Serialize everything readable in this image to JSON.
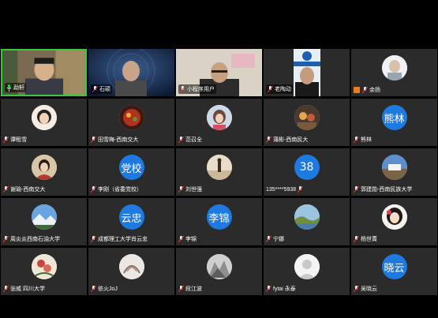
{
  "colors": {
    "background": "#000000",
    "tile": "#2b2b2b",
    "speaking_border": "#37c93d",
    "initials_bubble": "#1f7ae0",
    "mic_muted": "#e53935",
    "mic_active": "#ffffff"
  },
  "participants": [
    {
      "name": "勐轩",
      "type": "video",
      "speaking": true,
      "mic": "active"
    },
    {
      "name": "石硕",
      "type": "video",
      "mic": "muted"
    },
    {
      "name": "小程序用户",
      "type": "video",
      "mic": "muted"
    },
    {
      "name": "老陶动",
      "type": "video",
      "mic": "muted"
    },
    {
      "name": "余扬",
      "type": "avatar",
      "mic": "muted",
      "badge": "orange"
    },
    {
      "name": "谭租雪",
      "type": "avatar",
      "mic": "muted"
    },
    {
      "name": "田雪梅-西南交大",
      "type": "avatar",
      "mic": "muted"
    },
    {
      "name": "范召全",
      "type": "avatar",
      "mic": "muted"
    },
    {
      "name": "蒲彬-西南民大",
      "type": "avatar",
      "mic": "muted"
    },
    {
      "name": "熊林",
      "type": "initials",
      "initials": "熊林",
      "mic": "muted"
    },
    {
      "name": "谢瑜-西南交大",
      "type": "avatar",
      "mic": "muted"
    },
    {
      "name": "李刚（省委党校）",
      "type": "initials",
      "initials": "党校",
      "mic": "muted"
    },
    {
      "name": "刘世强",
      "type": "avatar",
      "mic": "muted"
    },
    {
      "name": "135****5938",
      "type": "initials",
      "initials": "38",
      "mic": "muted"
    },
    {
      "name": "郭建勋-西南民族大学",
      "type": "avatar",
      "mic": "muted"
    },
    {
      "name": "周炎炎西南石油大学",
      "type": "avatar",
      "mic": "muted"
    },
    {
      "name": "成都理工大学肖云忠",
      "type": "initials",
      "initials": "云忠",
      "mic": "muted"
    },
    {
      "name": "李锦",
      "type": "initials",
      "initials": "李锦",
      "mic": "muted"
    },
    {
      "name": "宁娜",
      "type": "avatar",
      "mic": "muted"
    },
    {
      "name": "杨世菁",
      "type": "avatar",
      "mic": "muted"
    },
    {
      "name": "张威 四川大学",
      "type": "avatar",
      "mic": "muted"
    },
    {
      "name": "依火JoJ",
      "type": "avatar",
      "mic": "muted"
    },
    {
      "name": "段江波",
      "type": "avatar",
      "mic": "muted"
    },
    {
      "name": "fytai 永泰",
      "type": "avatar",
      "mic": "muted"
    },
    {
      "name": "吴晓云",
      "type": "initials",
      "initials": "晓云",
      "mic": "muted"
    }
  ]
}
